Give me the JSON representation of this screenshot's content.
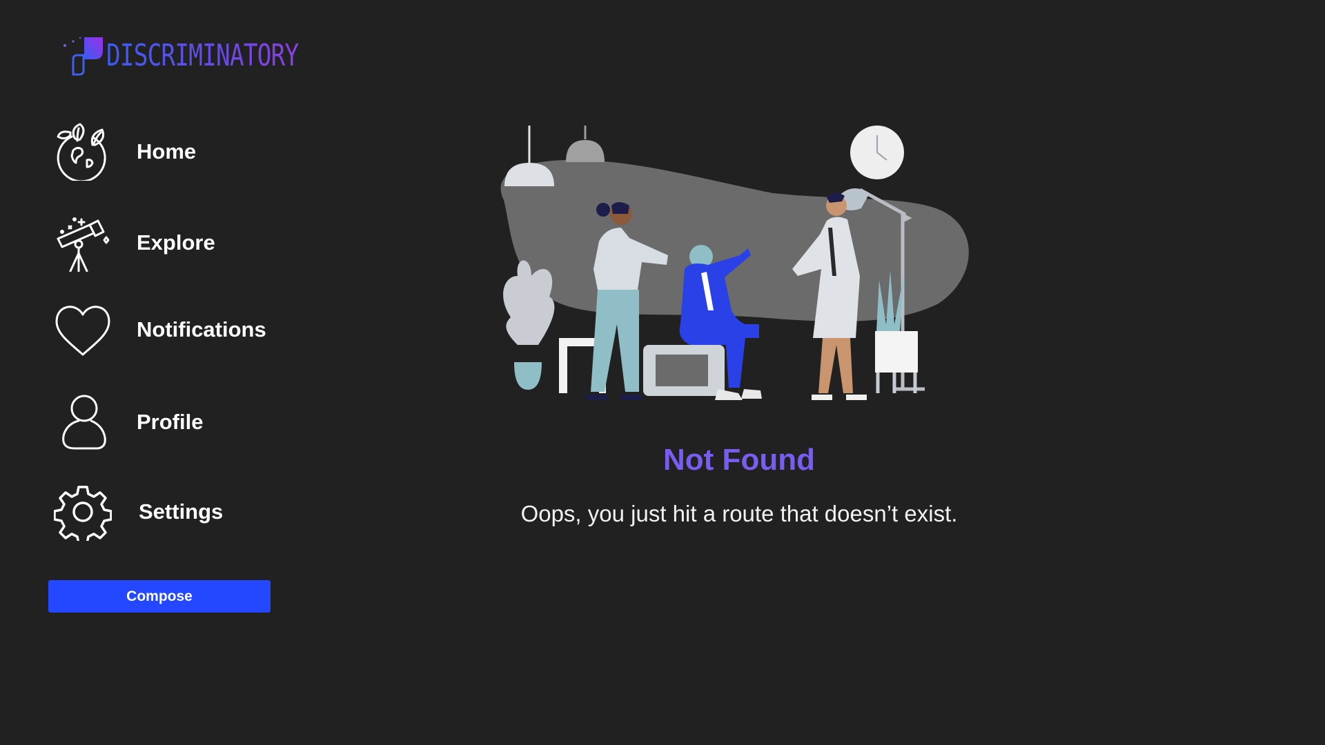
{
  "brand": {
    "name": "DISCRIMINATORY"
  },
  "colors": {
    "background": "#212121",
    "accent": "#7a5cf0",
    "compose": "#2448ff"
  },
  "sidebar": {
    "items": [
      {
        "label": "Home",
        "icon": "globe-leaves-icon"
      },
      {
        "label": "Explore",
        "icon": "telescope-icon"
      },
      {
        "label": "Notifications",
        "icon": "heart-icon"
      },
      {
        "label": "Profile",
        "icon": "person-icon"
      },
      {
        "label": "Settings",
        "icon": "gear-icon"
      }
    ],
    "compose_label": "Compose"
  },
  "main": {
    "illustration": "people-meeting-illustration",
    "title": "Not Found",
    "message": "Oops, you just hit a route that doesn’t exist."
  }
}
